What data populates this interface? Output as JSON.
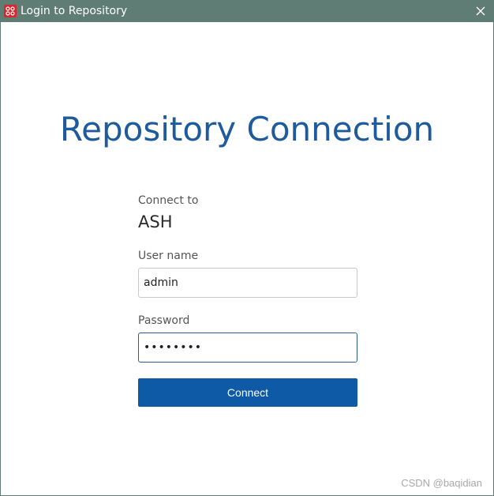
{
  "window": {
    "title": "Login to Repository",
    "app_icon": "red-app-logo-icon",
    "close_icon": "close-icon"
  },
  "main": {
    "heading": "Repository Connection",
    "connect_to_label": "Connect to",
    "repository_name": "ASH",
    "username_label": "User name",
    "username_value": "admin",
    "password_label": "Password",
    "password_value": "••••••••",
    "connect_button_label": "Connect"
  },
  "watermark": "CSDN @baqidian",
  "colors": {
    "titlebar": "#5f7d74",
    "heading": "#1e5a9e",
    "button": "#0e5aa7",
    "focus_border": "#2a5d95"
  }
}
